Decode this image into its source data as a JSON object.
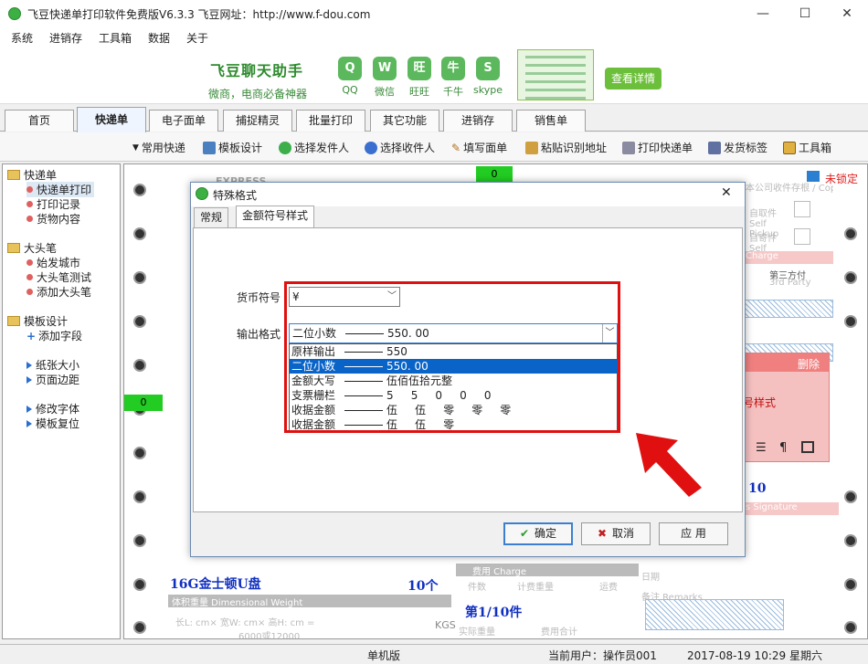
{
  "window": {
    "title": "飞豆快递单打印软件免费版V6.3.3   飞豆网址：http://www.f-dou.com",
    "minimize": "—",
    "maximize": "☐",
    "close": "✕"
  },
  "menu": [
    "系统",
    "进销存",
    "工具箱",
    "数据",
    "关于"
  ],
  "banner": {
    "slogan": "飞豆聊天助手",
    "sub": "微商，电商必备神器",
    "apps": [
      {
        "label": "QQ",
        "icon": "qq-icon",
        "glyph": "Q"
      },
      {
        "label": "微信",
        "icon": "wechat-icon",
        "glyph": "W"
      },
      {
        "label": "旺旺",
        "icon": "wangwang-icon",
        "glyph": "旺"
      },
      {
        "label": "千牛",
        "icon": "qianniu-icon",
        "glyph": "牛"
      },
      {
        "label": "skype",
        "icon": "skype-icon",
        "glyph": "S"
      }
    ],
    "detail": "查看详情"
  },
  "tabs": [
    "首页",
    "快递单",
    "电子面单",
    "捕捉精灵",
    "批量打印",
    "其它功能",
    "进销存",
    "销售单"
  ],
  "active_tab": "快递单",
  "toolbar": [
    {
      "label": "常用快递",
      "icon": "dropdown-icon"
    },
    {
      "label": "模板设计",
      "icon": "design-icon"
    },
    {
      "label": "选择发件人",
      "icon": "sender-icon"
    },
    {
      "label": "选择收件人",
      "icon": "receiver-icon"
    },
    {
      "label": "填写面单",
      "icon": "pen-icon"
    },
    {
      "label": "粘贴识别地址",
      "icon": "paste-icon"
    },
    {
      "label": "打印快递单",
      "icon": "printer-icon"
    },
    {
      "label": "发货标签",
      "icon": "label-icon"
    },
    {
      "label": "工具箱",
      "icon": "toolbox-icon"
    }
  ],
  "sidebar": {
    "groups": [
      {
        "label": "快递单",
        "items": [
          "快递单打印",
          "打印记录",
          "货物内容"
        ]
      },
      {
        "label": "大头笔",
        "items": [
          "始发城市",
          "大头笔测试",
          "添加大头笔"
        ]
      },
      {
        "label": "模板设计",
        "items": [
          "添加字段",
          "纸张大小",
          "页面边距",
          "修改字体",
          "模板复位"
        ]
      }
    ]
  },
  "canvas": {
    "lock_label": "未锁定",
    "green_counter_top": "0",
    "green_counter_left": "0",
    "product": "16G金士顿U盘",
    "qty": "10个",
    "page": "第1/10件",
    "num10": "10",
    "delete": "删除",
    "panel_text": "号样式",
    "express_header": "EXPRESS",
    "sf_express": "本公司收件存根 / Copy: S.F. Express",
    "charge": "Charge",
    "charge2": "费用 Charge",
    "third_party": "第三方付",
    "third_party_en": "3rd Party",
    "self_pickup": "自取件 Self Pickup",
    "self_send": "自寄件 Self Send",
    "signature": "s Signature",
    "dim_weight": "体积重量 Dimensional Weight",
    "dims": "长L:    cm×  宽W:    cm×  高H:    cm =",
    "dims2": "6000或12000",
    "remarks": "备注 Remarks",
    "kgs": "KGS",
    "actual_weight": "实际重量",
    "total_fee": "费用合计",
    "pieces": "件数",
    "charged_weight": "计费重量",
    "freight": "运费",
    "date": "日期"
  },
  "dialog": {
    "title": "特殊格式",
    "tabs": [
      "常规",
      "金额符号样式"
    ],
    "active_tab": "金额符号样式",
    "currency_label": "货币符号",
    "currency_value": "¥",
    "format_label": "输出格式",
    "format_value_name": "二位小数",
    "format_value_sample": "550. 00",
    "options": [
      {
        "name": "原样输出",
        "sample": "550"
      },
      {
        "name": "二位小数",
        "sample": "550. 00"
      },
      {
        "name": "金额大写",
        "sample": "伍佰伍拾元整"
      },
      {
        "name": "支票栅栏",
        "sample": "5     5     0     0     0"
      },
      {
        "name": "收据金额",
        "sample": "伍     伍     零     零     零"
      },
      {
        "name": "收据金额",
        "sample": "伍     伍     零"
      }
    ],
    "selected_index": 1,
    "ok": "确定",
    "cancel": "取消",
    "apply": "应 用"
  },
  "status": {
    "mode": "单机版",
    "user": "当前用户：操作员001",
    "datetime": "2017-08-19 10:29 星期六"
  }
}
